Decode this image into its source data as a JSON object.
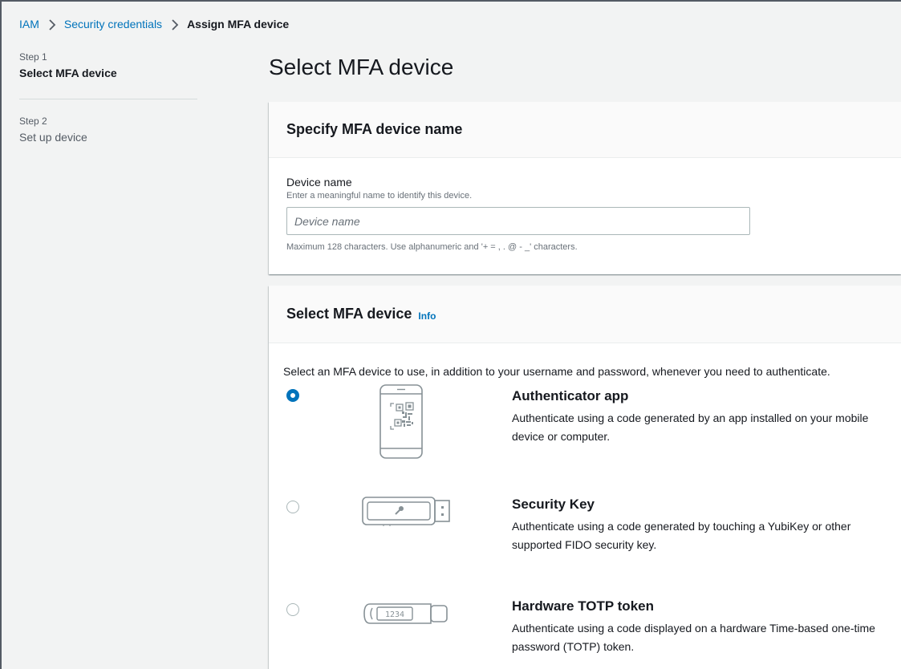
{
  "breadcrumb": {
    "items": [
      "IAM",
      "Security credentials"
    ],
    "current": "Assign MFA device"
  },
  "steps": [
    {
      "number": "Step 1",
      "title": "Select MFA device",
      "active": true
    },
    {
      "number": "Step 2",
      "title": "Set up device",
      "active": false
    }
  ],
  "page": {
    "title": "Select MFA device"
  },
  "device_name_panel": {
    "header": "Specify MFA device name",
    "label": "Device name",
    "description": "Enter a meaningful name to identify this device.",
    "placeholder": "Device name",
    "value": "",
    "constraint": "Maximum 128 characters. Use alphanumeric and '+ = , . @ - _' characters."
  },
  "mfa_panel": {
    "header": "Select MFA device",
    "info_label": "Info",
    "description": "Select an MFA device to use, in addition to your username and password, whenever you need to authenticate.",
    "options": [
      {
        "title": "Authenticator app",
        "description": "Authenticate using a code generated by an app installed on your mobile device or computer.",
        "selected": true,
        "icon": "phone-qr-icon"
      },
      {
        "title": "Security Key",
        "description": "Authenticate using a code generated by touching a YubiKey or other supported FIDO security key.",
        "selected": false,
        "icon": "usb-key-icon"
      },
      {
        "title": "Hardware TOTP token",
        "description": "Authenticate using a code displayed on a hardware Time-based one-time password (TOTP) token.",
        "selected": false,
        "icon": "totp-token-icon",
        "token_display": "1234"
      }
    ]
  },
  "colors": {
    "link": "#0073bb",
    "background": "#f2f3f3",
    "panel_header": "#fafafa"
  }
}
